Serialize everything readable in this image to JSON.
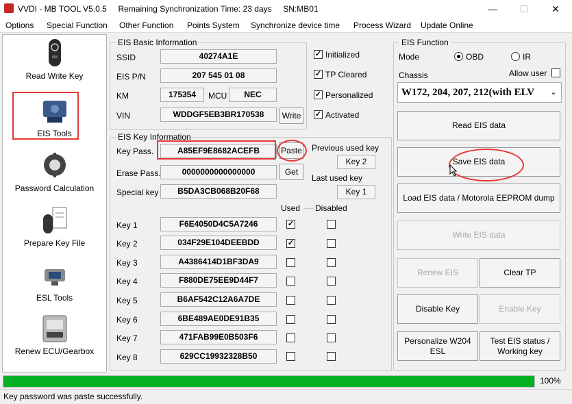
{
  "window": {
    "title": "VVDI - MB TOOL V5.0.5     Remaining Synchronization Time: 23 days     SN:MB01",
    "min": "—",
    "max": "☐",
    "close": "✕"
  },
  "menu": [
    "Options",
    "Special Function",
    "Other Function",
    "Points System",
    "Synchronize device time",
    "Process Wizard",
    "Update Online"
  ],
  "sidebar": [
    {
      "label": "Read Write Key"
    },
    {
      "label": "EIS Tools"
    },
    {
      "label": "Password Calculation"
    },
    {
      "label": "Prepare Key File"
    },
    {
      "label": "ESL Tools"
    },
    {
      "label": "Renew ECU/Gearbox"
    }
  ],
  "eis_basic": {
    "title": "EIS Basic Information",
    "ssid_label": "SSID",
    "ssid": "40274A1E",
    "pn_label": "EIS P/N",
    "pn": "207 545 01 08",
    "km_label": "KM",
    "km": "175354",
    "mcu_label": "MCU",
    "mcu": "NEC",
    "vin_label": "VIN",
    "vin": "WDDGF5EB3BR170538",
    "write_btn": "Write",
    "initialized": "Initialized",
    "tp_cleared": "TP Cleared",
    "personalized": "Personalized",
    "activated": "Activated"
  },
  "eis_key": {
    "title": "EIS Key Information",
    "keypass_label": "Key Pass.",
    "keypass": "A85EF9E8682ACEFB",
    "paste_btn": "Paste",
    "erase_label": "Erase Pass.",
    "erase": "0000000000000000",
    "get_btn": "Get",
    "special_label": "Special key",
    "special": "B5DA3CB068B20F68",
    "prev_key_label": "Previous used key",
    "prev_key": "Key 2",
    "last_key_label": "Last used key",
    "last_key": "Key 1",
    "used_label": "Used",
    "disabled_label": "Disabled",
    "keys": [
      {
        "label": "Key 1",
        "value": "F6E4050D4C5A7246",
        "used": "✓"
      },
      {
        "label": "Key 2",
        "value": "034F29E104DEEBDD",
        "used": "✓"
      },
      {
        "label": "Key 3",
        "value": "A4386414D1BF3DA9",
        "used": ""
      },
      {
        "label": "Key 4",
        "value": "F880DE75EE9D44F7",
        "used": ""
      },
      {
        "label": "Key 5",
        "value": "B6AF542C12A6A7DE",
        "used": ""
      },
      {
        "label": "Key 6",
        "value": "6BE489AE0DE91B35",
        "used": ""
      },
      {
        "label": "Key 7",
        "value": "471FAB99E0B503F6",
        "used": ""
      },
      {
        "label": "Key 8",
        "value": "629CC19932328B50",
        "used": ""
      }
    ]
  },
  "eis_function": {
    "title": "EIS Function",
    "mode_label": "Mode",
    "obd": "OBD",
    "ir": "IR",
    "chassis_label": "Chassis",
    "allow_user": "Allow user",
    "chassis_value": "W172, 204, 207, 212(with ELV",
    "read_btn": "Read EIS data",
    "save_btn": "Save EIS data",
    "load_btn": "Load EIS data / Motorola EEPROM dump",
    "write_btn": "Write EIS data",
    "renew_btn": "Renew EIS",
    "clear_tp_btn": "Clear TP",
    "disable_btn": "Disable Key",
    "enable_btn": "Enable Key",
    "personalize_btn": "Personalize W204\nESL",
    "test_btn": "Test EIS status /\nWorking key"
  },
  "progress": {
    "value": 100,
    "label": "100%"
  },
  "status": "Key password was paste successfully.",
  "colors": {
    "accent_red": "#e53935",
    "progress_green": "#06b025"
  }
}
